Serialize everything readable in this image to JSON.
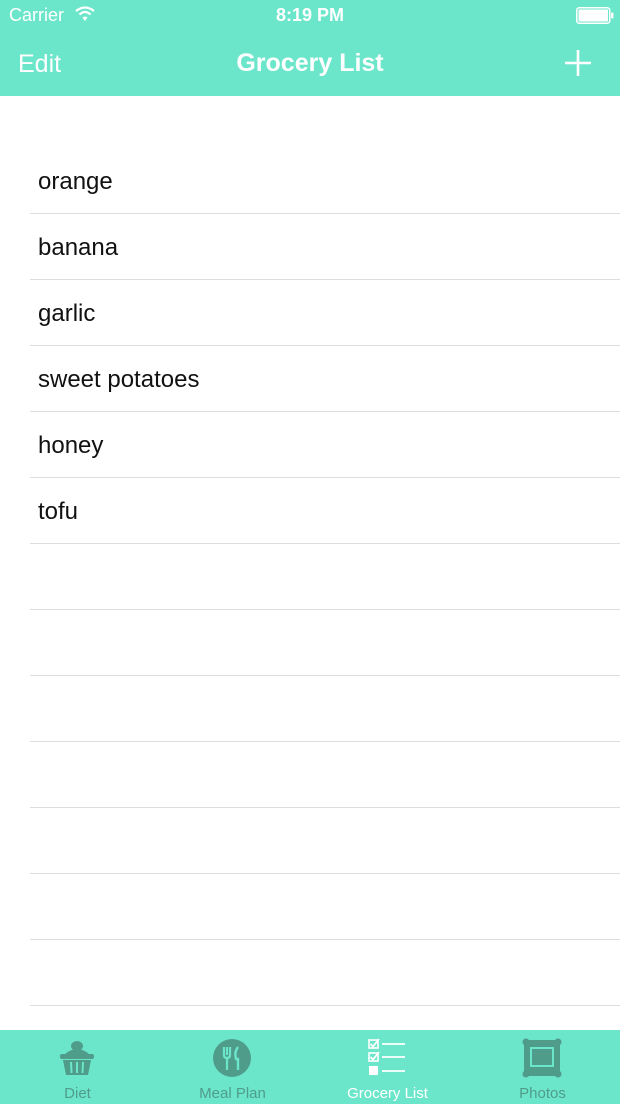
{
  "status_bar": {
    "carrier": "Carrier",
    "time": "8:19 PM"
  },
  "nav": {
    "edit_label": "Edit",
    "title": "Grocery List",
    "add_icon": "plus-icon"
  },
  "grocery_items": [
    "orange",
    "banana",
    "garlic",
    "sweet potatoes",
    "honey",
    "tofu",
    "",
    "",
    "",
    "",
    "",
    "",
    "",
    ""
  ],
  "tabs": [
    {
      "label": "Diet",
      "icon": "basket-icon",
      "active": false
    },
    {
      "label": "Meal Plan",
      "icon": "fork-knife-icon",
      "active": false
    },
    {
      "label": "Grocery List",
      "icon": "checklist-icon",
      "active": true
    },
    {
      "label": "Photos",
      "icon": "picture-frame-icon",
      "active": false
    }
  ],
  "colors": {
    "accent": "#6ce6ca",
    "inactive_icon": "#4f9c8a",
    "active_icon": "#ffffff"
  }
}
